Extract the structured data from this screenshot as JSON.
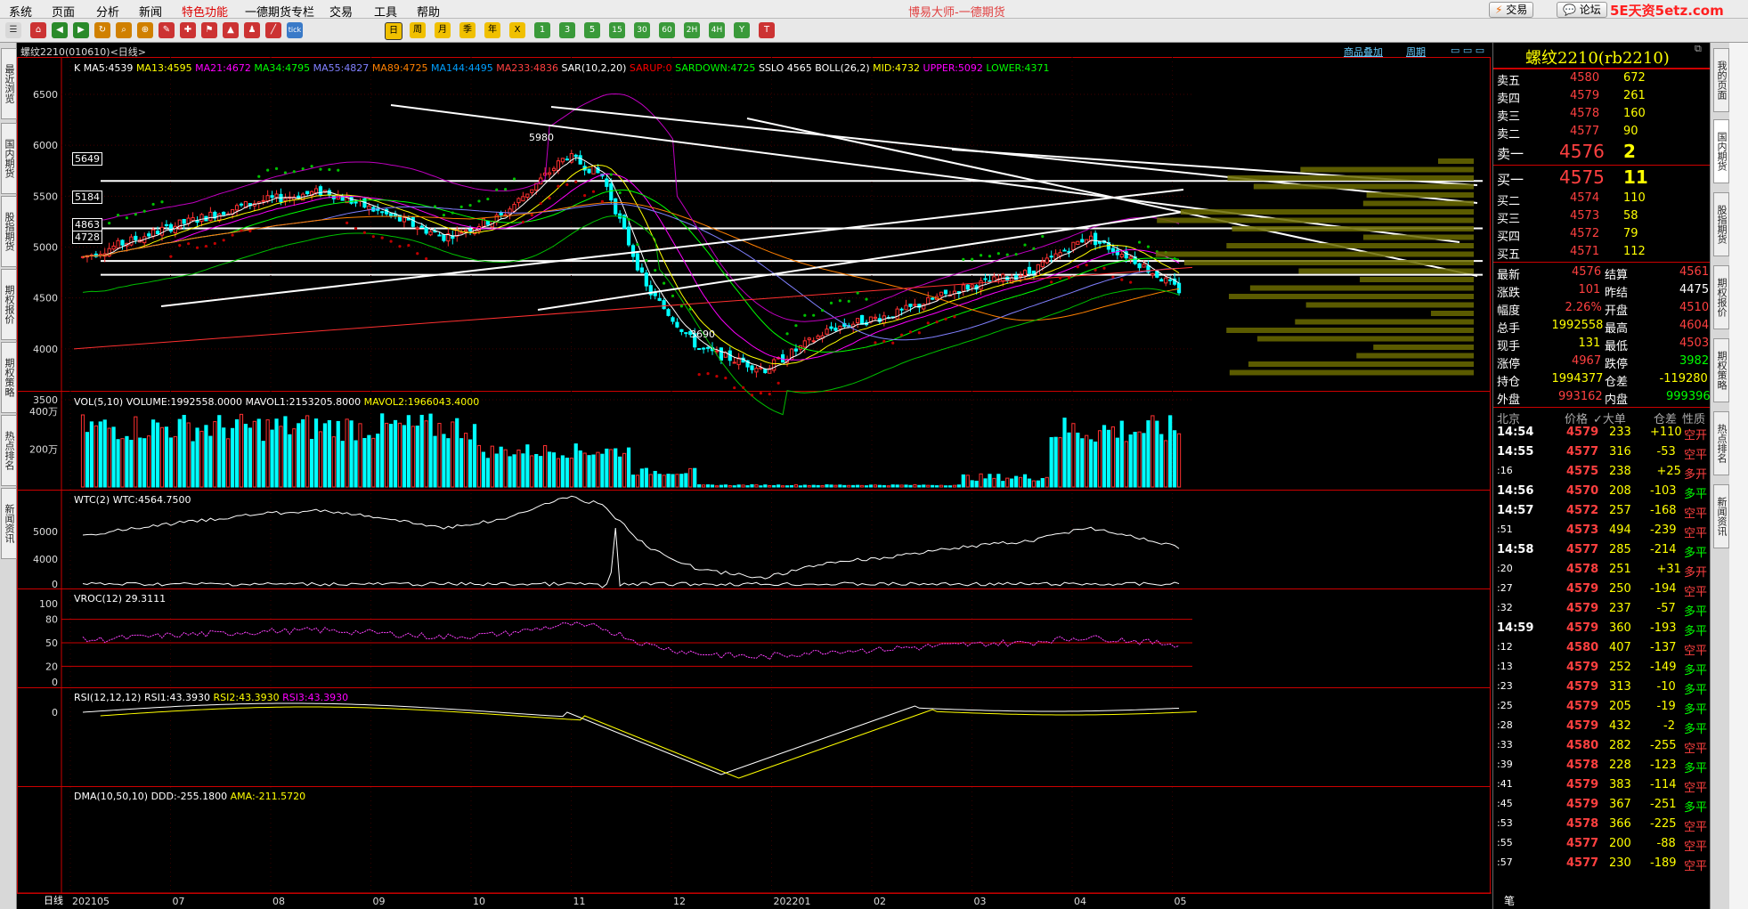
{
  "app_title": "博易大师-一德期货",
  "menu": [
    "系统",
    "页面",
    "分析",
    "新闻",
    "特色功能",
    "一德期货专栏",
    "交易",
    "工具",
    "帮助"
  ],
  "menu_right": {
    "trade_btn": "交易",
    "forum_btn": "论坛",
    "watermark": "5E天资5etz.com"
  },
  "toolbar_icons": [
    "home-icon",
    "back-icon",
    "forward-icon",
    "refresh-icon",
    "search-icon",
    "zoom-icon",
    "draw-icon",
    "pin-icon",
    "tick-icon",
    "1m-icon",
    "5m-icon",
    "15m-icon",
    "30m-icon",
    "60m-icon",
    "day-icon",
    "week-icon",
    "month-icon",
    "season-icon",
    "year-icon",
    "custom-icon"
  ],
  "toolbar_labels": [
    "tick",
    "日",
    "周",
    "月",
    "季",
    "年",
    "X",
    "1",
    "3",
    "5",
    "15",
    "30",
    "60",
    "2H",
    "4H",
    "Y",
    "T"
  ],
  "left_tabs": [
    "最近浏览",
    "国内期货",
    "股指期货",
    "期权报价",
    "期权策略",
    "热点排名",
    "新闻资讯"
  ],
  "right_tabs": [
    "我的页面",
    "国内期货",
    "股指期货",
    "期权报价",
    "期权策略",
    "热点排名",
    "新闻资讯"
  ],
  "chart": {
    "title": "螺纹2210(010610)<日线>",
    "link_goods": "商品叠加",
    "link_period": "周期",
    "period_label": "日线",
    "ma_line": [
      {
        "t": "K",
        "c": "#ffffff"
      },
      {
        "t": "MA5:4539",
        "c": "#ffffff"
      },
      {
        "t": "MA13:4595",
        "c": "#ffff00"
      },
      {
        "t": "MA21:4672",
        "c": "#ff00ff"
      },
      {
        "t": "MA34:4795",
        "c": "#00ff00"
      },
      {
        "t": "MA55:4827",
        "c": "#8080ff"
      },
      {
        "t": "MA89:4725",
        "c": "#ff8000"
      },
      {
        "t": "MA144:4495",
        "c": "#00a0ff"
      },
      {
        "t": "MA233:4836",
        "c": "#ff4040"
      },
      {
        "t": "SAR(10,2,20)",
        "c": "#ffffff"
      },
      {
        "t": "SARUP:0",
        "c": "#ff0000"
      },
      {
        "t": "SARDOWN:4725",
        "c": "#00ff00"
      },
      {
        "t": "SSLO 4565",
        "c": "#ffffff"
      },
      {
        "t": "BOLL(26,2)",
        "c": "#ffffff"
      },
      {
        "t": "MID:4732",
        "c": "#ffff00"
      },
      {
        "t": "UPPER:5092",
        "c": "#ff00ff"
      },
      {
        "t": "LOWER:4371",
        "c": "#00ff00"
      }
    ],
    "price_axis": [
      "6500",
      "6000",
      "5500",
      "5000",
      "4500",
      "4000",
      "3500"
    ],
    "price_marks": [
      "5649",
      "5184",
      "4863",
      "4728"
    ],
    "peak_label": "5980",
    "trough_label": "3690",
    "vol_title": "VOL(5,10)",
    "vol_values": [
      {
        "t": "VOLUME:1992558.0000",
        "c": "#ffffff"
      },
      {
        "t": "MAVOL1:2153205.8000",
        "c": "#ffffff"
      },
      {
        "t": "MAVOL2:1966043.4000",
        "c": "#ffff00"
      }
    ],
    "vol_axis": [
      "400万",
      "200万"
    ],
    "wtc_title": "WTC(2)",
    "wtc_value": "WTC:4564.7500",
    "wtc_axis": [
      "5000"
    ],
    "vroc_title": "VROC(12)",
    "vroc_value": "29.3111",
    "vroc_axis": [
      "4000",
      "0"
    ],
    "rsi_title": "RSI(12,12,12)",
    "rsi_values": [
      {
        "t": "RSI1:43.3930",
        "c": "#ffffff"
      },
      {
        "t": "RSI2:43.3930",
        "c": "#ffff00"
      },
      {
        "t": "RSI3:43.3930",
        "c": "#ff00ff"
      }
    ],
    "rsi_axis": [
      "100",
      "80",
      "50",
      "20",
      "0"
    ],
    "dma_title": "DMA(10,50,10)",
    "dma_values": [
      {
        "t": "DDD:-255.1800",
        "c": "#ffffff"
      },
      {
        "t": "AMA:-211.5720",
        "c": "#ffff00"
      }
    ],
    "dma_axis": [
      "0"
    ],
    "x_axis": [
      "202105",
      "07",
      "08",
      "09",
      "10",
      "11",
      "12",
      "202201",
      "02",
      "03",
      "04",
      "05"
    ]
  },
  "quote": {
    "title": "螺纹2210(rb2210)",
    "sells": [
      {
        "label": "卖五",
        "price": "4580",
        "vol": "672"
      },
      {
        "label": "卖四",
        "price": "4579",
        "vol": "261"
      },
      {
        "label": "卖三",
        "price": "4578",
        "vol": "160"
      },
      {
        "label": "卖二",
        "price": "4577",
        "vol": "90"
      },
      {
        "label": "卖一",
        "price": "4576",
        "vol": "2"
      }
    ],
    "buys": [
      {
        "label": "买一",
        "price": "4575",
        "vol": "11"
      },
      {
        "label": "买二",
        "price": "4574",
        "vol": "110"
      },
      {
        "label": "买三",
        "price": "4573",
        "vol": "58"
      },
      {
        "label": "买四",
        "price": "4572",
        "vol": "79"
      },
      {
        "label": "买五",
        "price": "4571",
        "vol": "112"
      }
    ],
    "stats": [
      {
        "l1": "最新",
        "v1": "4576",
        "c1": "red",
        "l2": "结算",
        "v2": "4561",
        "c2": "red"
      },
      {
        "l1": "涨跌",
        "v1": "101",
        "c1": "red",
        "l2": "昨结",
        "v2": "4475",
        "c2": "wht"
      },
      {
        "l1": "幅度",
        "v1": "2.26%",
        "c1": "red",
        "l2": "开盘",
        "v2": "4510",
        "c2": "red"
      },
      {
        "l1": "总手",
        "v1": "1992558",
        "c1": "yel",
        "l2": "最高",
        "v2": "4604",
        "c2": "red"
      },
      {
        "l1": "现手",
        "v1": "131",
        "c1": "yel",
        "l2": "最低",
        "v2": "4503",
        "c2": "red"
      },
      {
        "l1": "涨停",
        "v1": "4967",
        "c1": "red",
        "l2": "跌停",
        "v2": "3982",
        "c2": "green"
      },
      {
        "l1": "持仓",
        "v1": "1994377",
        "c1": "yel",
        "l2": "仓差",
        "v2": "-119280",
        "c2": "yel"
      },
      {
        "l1": "外盘",
        "v1": "993162",
        "c1": "red",
        "l2": "内盘",
        "v2": "999396",
        "c2": "green"
      }
    ],
    "ticks_header": [
      "北京",
      "价格",
      "✓大单",
      "仓差",
      "性质"
    ],
    "ticks": [
      {
        "time": "14:54",
        "bold": true,
        "price": "4579",
        "vol": "233",
        "diff": "+110",
        "type": "空开",
        "tc": "red"
      },
      {
        "time": "14:55",
        "bold": true,
        "price": "4577",
        "vol": "316",
        "diff": "-53",
        "type": "空平",
        "tc": "red"
      },
      {
        "time": ":16",
        "bold": false,
        "price": "4575",
        "vol": "238",
        "diff": "+25",
        "type": "多开",
        "tc": "red"
      },
      {
        "time": "14:56",
        "bold": true,
        "price": "4570",
        "vol": "208",
        "diff": "-103",
        "type": "多平",
        "tc": "green"
      },
      {
        "time": "14:57",
        "bold": true,
        "price": "4572",
        "vol": "257",
        "diff": "-168",
        "type": "空平",
        "tc": "red"
      },
      {
        "time": ":51",
        "bold": false,
        "price": "4573",
        "vol": "494",
        "diff": "-239",
        "type": "空平",
        "tc": "red"
      },
      {
        "time": "14:58",
        "bold": true,
        "price": "4577",
        "vol": "285",
        "diff": "-214",
        "type": "多平",
        "tc": "green"
      },
      {
        "time": ":20",
        "bold": false,
        "price": "4578",
        "vol": "251",
        "diff": "+31",
        "type": "多开",
        "tc": "red"
      },
      {
        "time": ":27",
        "bold": false,
        "price": "4579",
        "vol": "250",
        "diff": "-194",
        "type": "空平",
        "tc": "red"
      },
      {
        "time": ":32",
        "bold": false,
        "price": "4579",
        "vol": "237",
        "diff": "-57",
        "type": "多平",
        "tc": "green"
      },
      {
        "time": "14:59",
        "bold": true,
        "price": "4579",
        "vol": "360",
        "diff": "-193",
        "type": "多平",
        "tc": "green"
      },
      {
        "time": ":12",
        "bold": false,
        "price": "4580",
        "vol": "407",
        "diff": "-137",
        "type": "空平",
        "tc": "red"
      },
      {
        "time": ":13",
        "bold": false,
        "price": "4579",
        "vol": "252",
        "diff": "-149",
        "type": "多平",
        "tc": "green"
      },
      {
        "time": ":23",
        "bold": false,
        "price": "4579",
        "vol": "313",
        "diff": "-10",
        "type": "多平",
        "tc": "green"
      },
      {
        "time": ":25",
        "bold": false,
        "price": "4579",
        "vol": "205",
        "diff": "-19",
        "type": "多平",
        "tc": "green"
      },
      {
        "time": ":28",
        "bold": false,
        "price": "4579",
        "vol": "432",
        "diff": "-2",
        "type": "多平",
        "tc": "green"
      },
      {
        "time": ":33",
        "bold": false,
        "price": "4580",
        "vol": "282",
        "diff": "-255",
        "type": "空平",
        "tc": "red"
      },
      {
        "time": ":39",
        "bold": false,
        "price": "4578",
        "vol": "228",
        "diff": "-123",
        "type": "多平",
        "tc": "green"
      },
      {
        "time": ":41",
        "bold": false,
        "price": "4579",
        "vol": "383",
        "diff": "-114",
        "type": "空平",
        "tc": "red"
      },
      {
        "time": ":45",
        "bold": false,
        "price": "4579",
        "vol": "367",
        "diff": "-251",
        "type": "多平",
        "tc": "green"
      },
      {
        "time": ":53",
        "bold": false,
        "price": "4578",
        "vol": "366",
        "diff": "-225",
        "type": "空平",
        "tc": "red"
      },
      {
        "time": ":55",
        "bold": false,
        "price": "4577",
        "vol": "200",
        "diff": "-88",
        "type": "空平",
        "tc": "red"
      },
      {
        "time": ":57",
        "bold": false,
        "price": "4577",
        "vol": "230",
        "diff": "-189",
        "type": "空平",
        "tc": "red"
      }
    ],
    "footer": "笔"
  }
}
